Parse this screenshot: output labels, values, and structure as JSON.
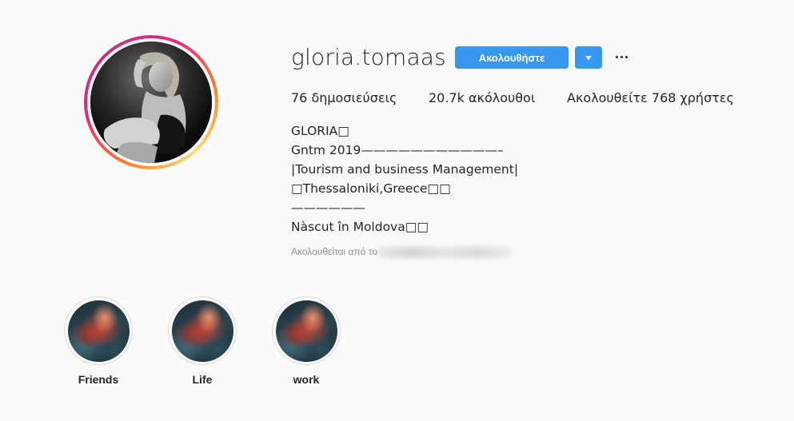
{
  "profile": {
    "username": "gloria.tomaas",
    "follow_label": "Ακολουθήστε",
    "dropdown_icon": "caret-down-icon",
    "more_icon": "more-options-icon"
  },
  "stats": {
    "posts": "76 δημοσιεύσεις",
    "followers": "20.7k ακόλουθοι",
    "following": "Ακολουθείτε 768 χρήστες"
  },
  "bio": {
    "lines": [
      "GLORIA□",
      "Gntm 2019———————————–",
      "|Tourism and business Management|",
      "□Thessaloniki,Greece□□",
      "——————",
      "Nàscut în Moldova□□"
    ],
    "followed_by": "Ακολουθείται από το"
  },
  "highlights": [
    {
      "label": "Friends"
    },
    {
      "label": "Life"
    },
    {
      "label": "work"
    }
  ],
  "colors": {
    "accent": "#3897f0",
    "text": "#262626",
    "muted": "#8e8e8e",
    "background": "#fafafa"
  }
}
